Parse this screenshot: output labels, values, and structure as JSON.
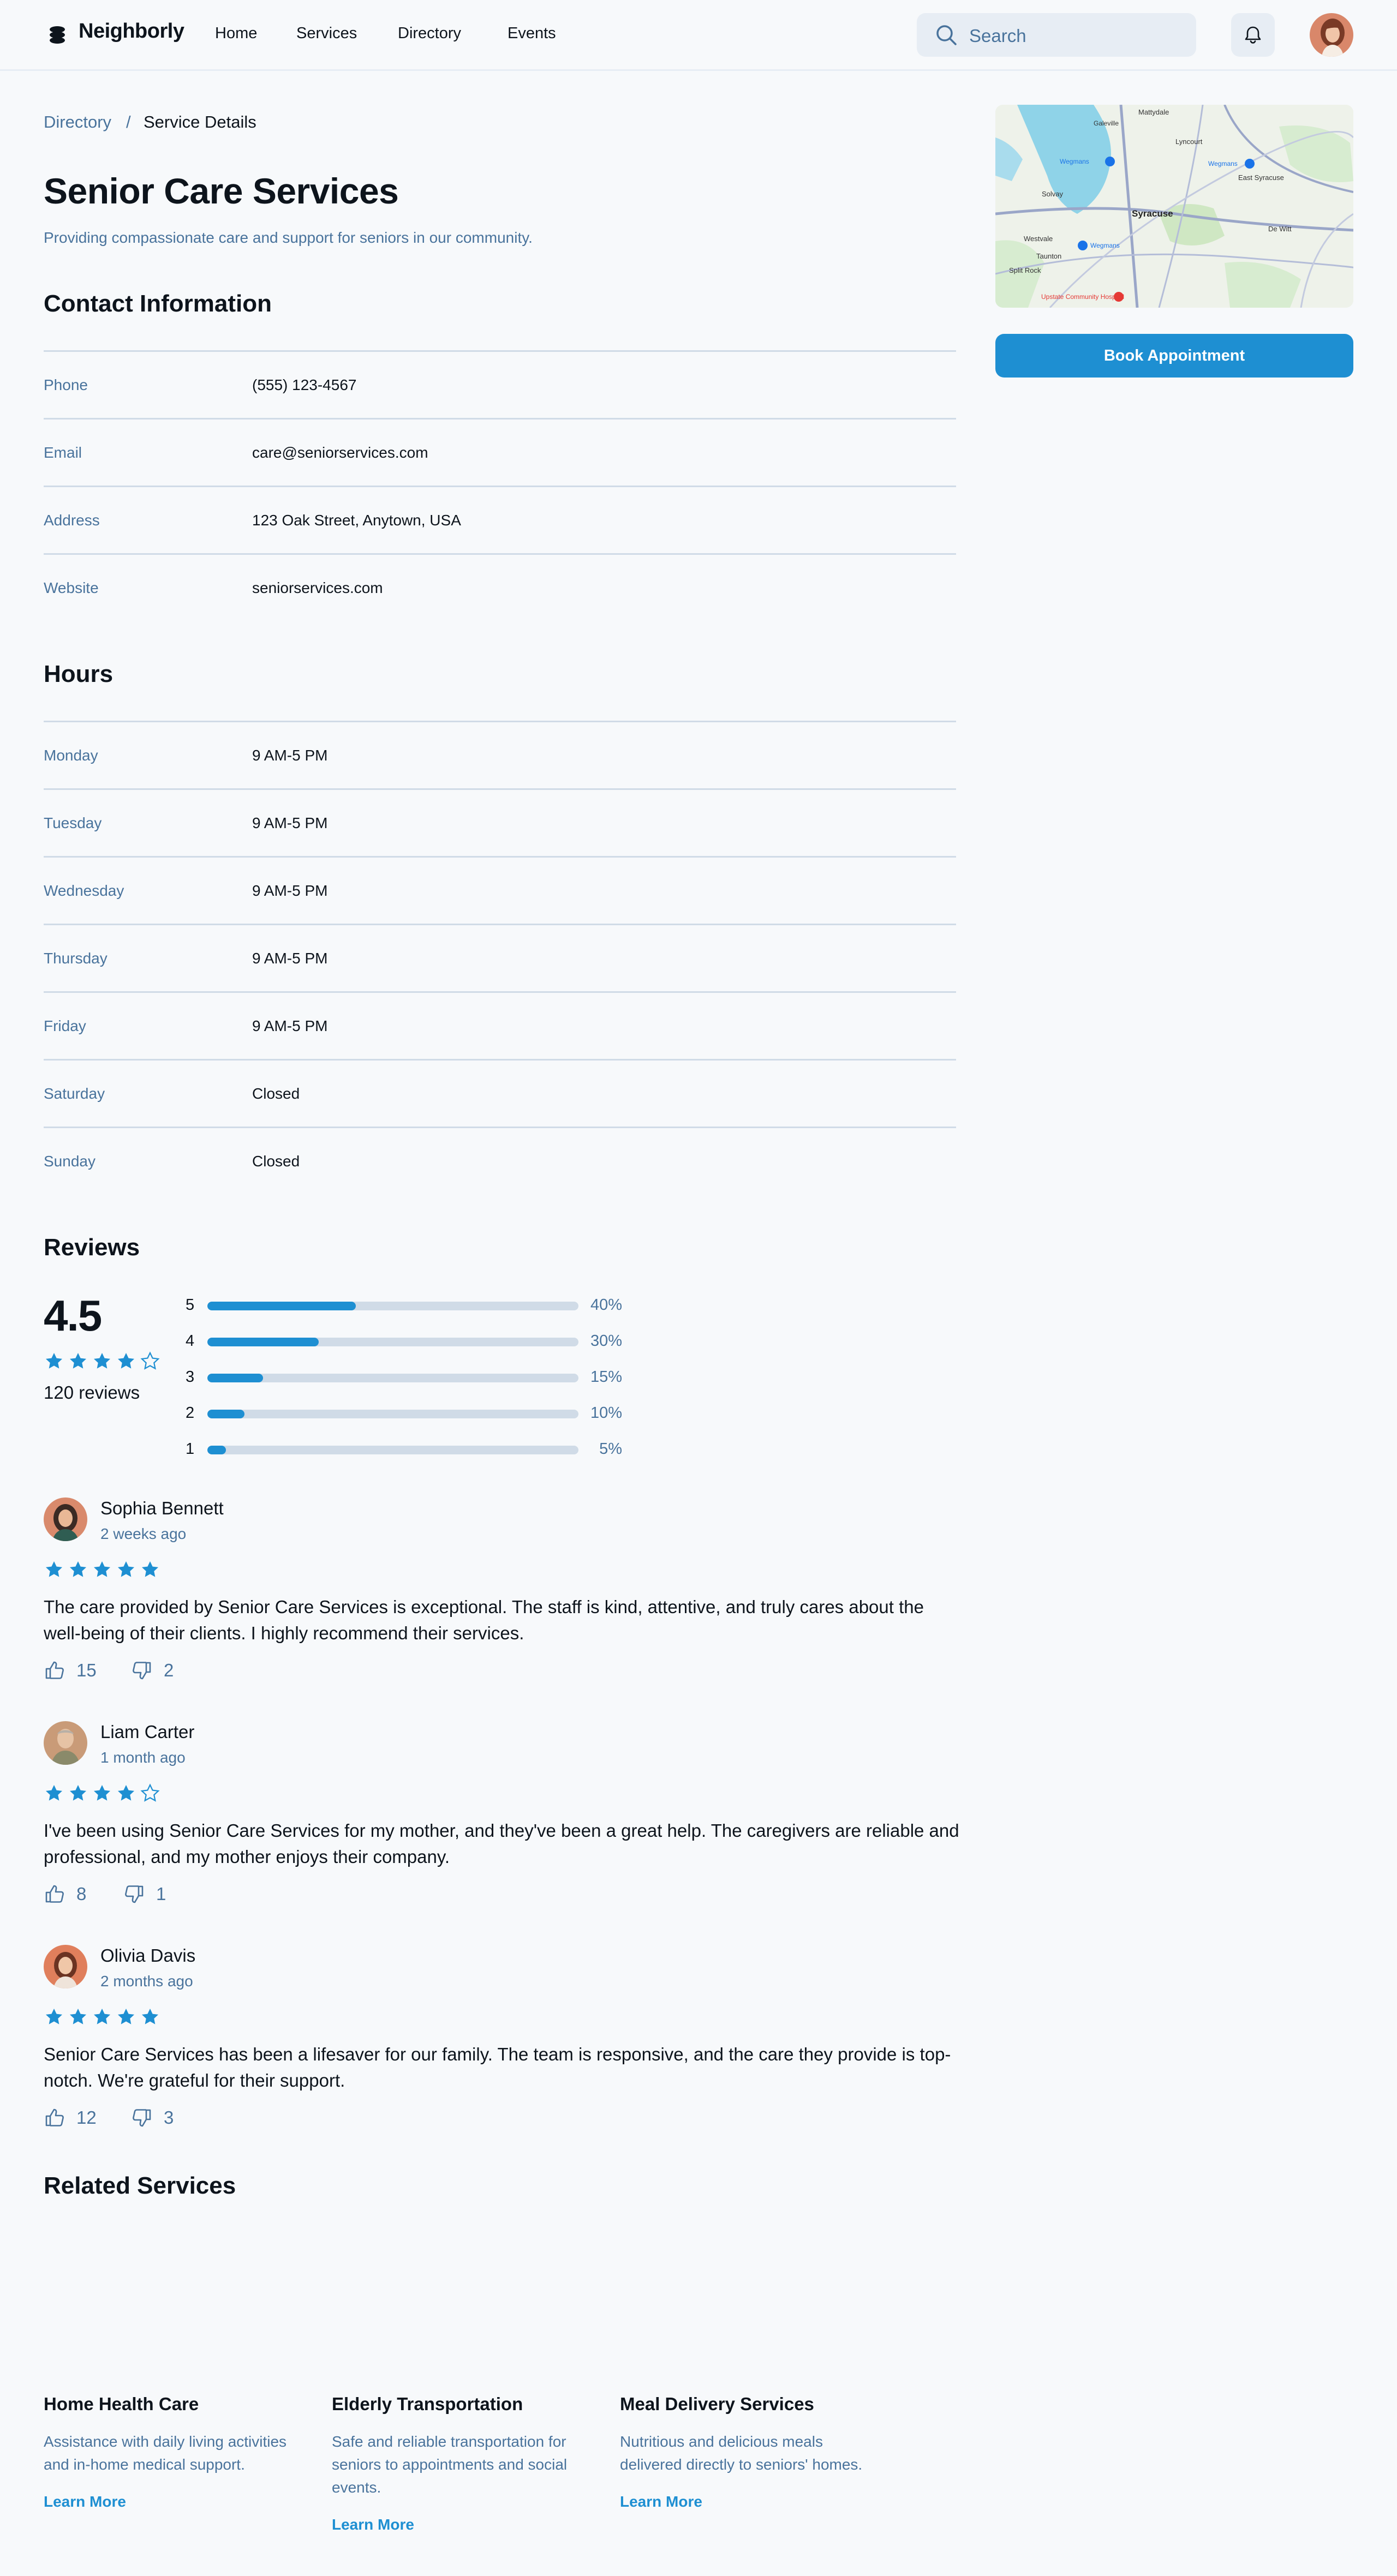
{
  "header": {
    "brand": "Neighborly",
    "nav": [
      "Home",
      "Services",
      "Directory",
      "Events"
    ],
    "search_placeholder": "Search"
  },
  "breadcrumb": {
    "parent": "Directory",
    "separator": "/",
    "current": "Service Details"
  },
  "page": {
    "title": "Senior Care Services",
    "subtitle": "Providing compassionate care and support for seniors in our community."
  },
  "contact": {
    "heading": "Contact Information",
    "rows": [
      {
        "label": "Phone",
        "value": "(555) 123-4567"
      },
      {
        "label": "Email",
        "value": "care@seniorservices.com"
      },
      {
        "label": "Address",
        "value": "123 Oak Street, Anytown, USA"
      },
      {
        "label": "Website",
        "value": "seniorservices.com"
      }
    ]
  },
  "hours": {
    "heading": "Hours",
    "rows": [
      {
        "label": "Monday",
        "value": "9 AM-5 PM"
      },
      {
        "label": "Tuesday",
        "value": "9 AM-5 PM"
      },
      {
        "label": "Wednesday",
        "value": "9 AM-5 PM"
      },
      {
        "label": "Thursday",
        "value": "9 AM-5 PM"
      },
      {
        "label": "Friday",
        "value": "9 AM-5 PM"
      },
      {
        "label": "Saturday",
        "value": "Closed"
      },
      {
        "label": "Sunday",
        "value": "Closed"
      }
    ]
  },
  "reviews": {
    "heading": "Reviews",
    "average": "4.5",
    "average_stars": 4,
    "count_label": "120 reviews",
    "breakdown": [
      {
        "stars": "5",
        "percent": "40%",
        "fraction": 0.4
      },
      {
        "stars": "4",
        "percent": "30%",
        "fraction": 0.3
      },
      {
        "stars": "3",
        "percent": "15%",
        "fraction": 0.15
      },
      {
        "stars": "2",
        "percent": "10%",
        "fraction": 0.1
      },
      {
        "stars": "1",
        "percent": "5%",
        "fraction": 0.05
      }
    ],
    "items": [
      {
        "name": "Sophia Bennett",
        "date": "2 weeks ago",
        "stars": 5,
        "text": "The care provided by Senior Care Services is exceptional. The staff is kind, attentive, and truly cares about the well-being of their clients. I highly recommend their services.",
        "likes": "15",
        "dislikes": "2"
      },
      {
        "name": "Liam Carter",
        "date": "1 month ago",
        "stars": 4,
        "text": "I've been using Senior Care Services for my mother, and they've been a great help. The caregivers are reliable and professional, and my mother enjoys their company.",
        "likes": "8",
        "dislikes": "1"
      },
      {
        "name": "Olivia Davis",
        "date": "2 months ago",
        "stars": 5,
        "text": "Senior Care Services has been a lifesaver for our family. The team is responsive, and the care they provide is top-notch. We're grateful for their support.",
        "likes": "12",
        "dislikes": "3"
      }
    ]
  },
  "related": {
    "heading": "Related Services",
    "items": [
      {
        "title": "Home Health Care",
        "desc": "Assistance with daily living activities and in-home medical support.",
        "link": "Learn More"
      },
      {
        "title": "Elderly Transportation",
        "desc": "Safe and reliable transportation for seniors to appointments and social events.",
        "link": "Learn More"
      },
      {
        "title": "Meal Delivery Services",
        "desc": "Nutritious and delicious meals delivered directly to seniors' homes.",
        "link": "Learn More"
      }
    ]
  },
  "sidebar": {
    "book_label": "Book Appointment",
    "map_labels": {
      "city": "Syracuse",
      "places": [
        "Mattydale",
        "Galeville",
        "Lyncourt",
        "East Syracuse",
        "Solvay",
        "Westvale",
        "Taunton",
        "Split Rock",
        "De Witt",
        "Wegmans",
        "Wegmans",
        "Wegmans",
        "Upstate Community Hospital"
      ]
    }
  },
  "colors": {
    "accent": "#1e8fd2",
    "muted": "#49739c",
    "border": "#d0dbe7",
    "surface": "#e7edf4"
  },
  "icons": [
    "logo-icon",
    "search-icon",
    "bell-icon",
    "star-icon",
    "thumbs-up-icon",
    "thumbs-down-icon",
    "map-pin-icon"
  ]
}
